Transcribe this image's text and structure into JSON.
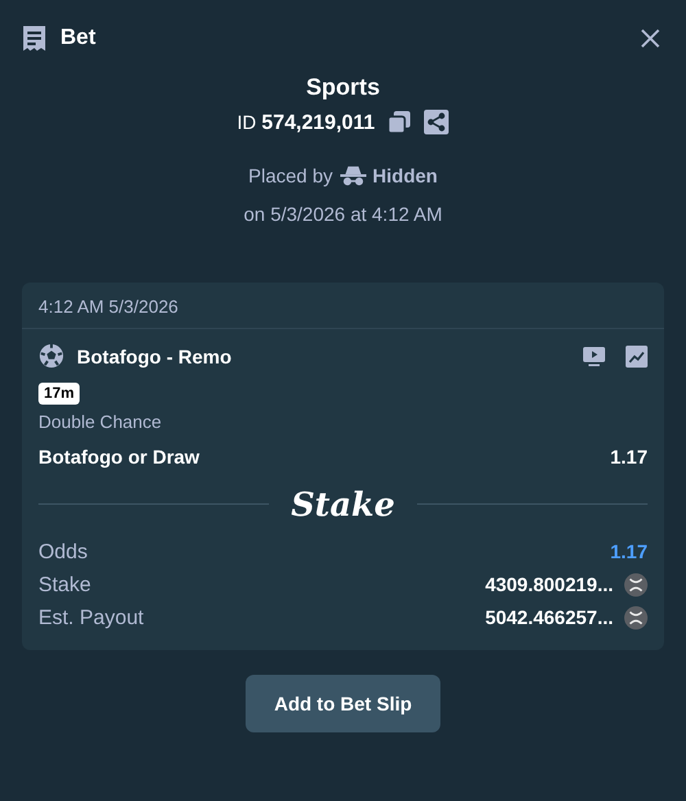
{
  "header": {
    "title": "Bet"
  },
  "summary": {
    "category": "Sports",
    "id_label": "ID",
    "id_value": "574,219,011",
    "placed_by_label": "Placed by",
    "placed_by_user": "Hidden",
    "placed_on": "on 5/3/2026 at 4:12 AM"
  },
  "card": {
    "timestamp": "4:12 AM 5/3/2026",
    "match": "Botafogo - Remo",
    "time_badge": "17m",
    "market": "Double Chance",
    "selection": "Botafogo or Draw",
    "selection_odds": "1.17",
    "logo": "Stake",
    "details": [
      {
        "label": "Odds",
        "value": "1.17",
        "kind": "odds"
      },
      {
        "label": "Stake",
        "value": "4309.800219...",
        "kind": "amount"
      },
      {
        "label": "Est. Payout",
        "value": "5042.466257...",
        "kind": "amount"
      }
    ]
  },
  "button": "Add to Bet Slip"
}
